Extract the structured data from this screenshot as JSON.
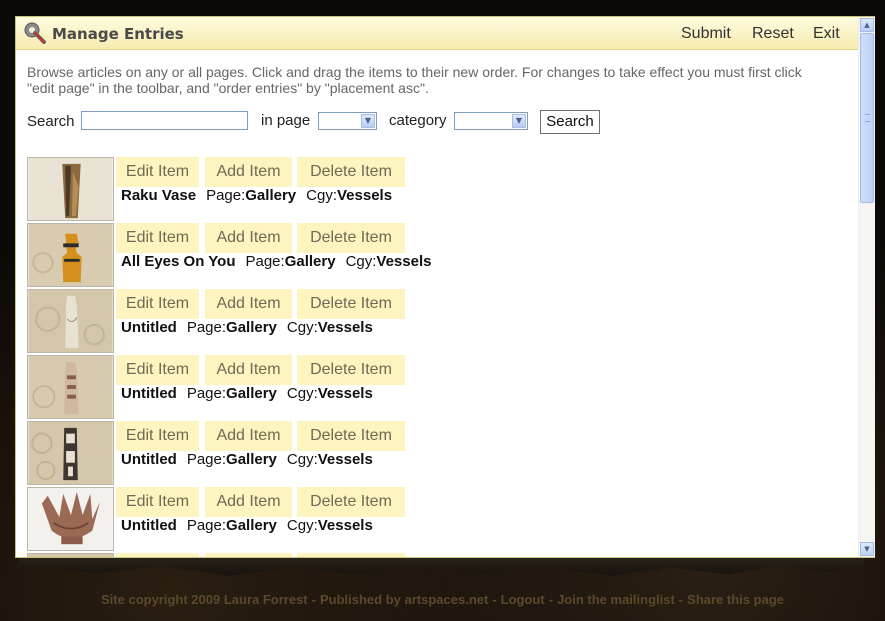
{
  "dialog": {
    "title": "Manage Entries",
    "actions": {
      "submit": "Submit",
      "reset": "Reset",
      "exit": "Exit"
    }
  },
  "intro": "Browse articles on any or all pages. Click and drag the items to their new order. For changes to take effect you must first click \"edit page\" in the toolbar, and \"order entries\" by \"placement asc\".",
  "filters": {
    "search_label": "Search",
    "search_value": "",
    "page_label": "in page",
    "page_selected": "",
    "category_label": "category",
    "category_selected": "",
    "search_button": "Search"
  },
  "item_actions": {
    "edit": "Edit Item",
    "add": "Add Item",
    "delete": "Delete Item"
  },
  "meta_labels": {
    "page": "Page:",
    "category": "Cgy:"
  },
  "entries": [
    {
      "title": "Raku Vase",
      "page": "Gallery",
      "category": "Vessels"
    },
    {
      "title": "All Eyes On You",
      "page": "Gallery",
      "category": "Vessels"
    },
    {
      "title": "Untitled",
      "page": "Gallery",
      "category": "Vessels"
    },
    {
      "title": "Untitled",
      "page": "Gallery",
      "category": "Vessels"
    },
    {
      "title": "Untitled",
      "page": "Gallery",
      "category": "Vessels"
    },
    {
      "title": "Untitled",
      "page": "Gallery",
      "category": "Vessels"
    }
  ],
  "footer": {
    "copyright": "Site copyright 2009 Laura Forrest",
    "published": "Published by artspaces.net",
    "logout": "Logout",
    "mailing": "Join the mailinglist",
    "share": "Share this page",
    "separator": "-"
  }
}
